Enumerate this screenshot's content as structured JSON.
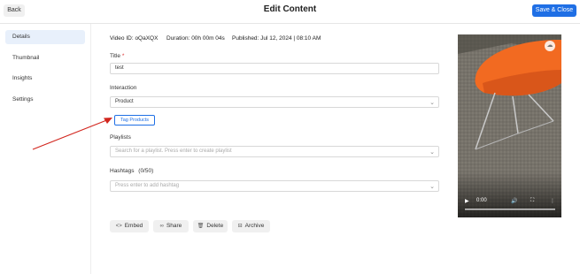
{
  "header": {
    "back_label": "Back",
    "title": "Edit Content",
    "save_label": "Save & Close"
  },
  "sidebar": {
    "items": [
      {
        "label": "Details",
        "active": true
      },
      {
        "label": "Thumbnail",
        "active": false
      },
      {
        "label": "Insights",
        "active": false
      },
      {
        "label": "Settings",
        "active": false
      }
    ]
  },
  "meta": {
    "video_id_label": "Video ID:",
    "video_id": "oQaXQX",
    "duration_label": "Duration:",
    "duration": "00h 00m 04s",
    "published_label": "Published:",
    "published": "Jul 12, 2024 | 08:10 AM"
  },
  "form": {
    "title_label": "Title",
    "title_required_mark": "*",
    "title_value": "test",
    "interaction_label": "Interaction",
    "interaction_value": "Product",
    "tag_products_label": "Tag Products",
    "playlists_label": "Playlists",
    "playlists_placeholder": "Search for a playlist. Press enter to create playlist",
    "hashtags_label": "Hashtags",
    "hashtags_count": "(0/50)",
    "hashtags_placeholder": "Press enter to add hashtag"
  },
  "actions": {
    "embed_label": "Embed",
    "share_label": "Share",
    "delete_label": "Delete",
    "archive_label": "Archive"
  },
  "video": {
    "time": "0:00"
  },
  "icons": {
    "embed": "code-icon",
    "share": "link-icon",
    "delete": "trash-icon",
    "archive": "archive-icon",
    "upload": "cloud-upload-icon",
    "play": "play-icon",
    "volume": "volume-icon",
    "fullscreen": "fullscreen-icon",
    "more": "more-vertical-icon"
  },
  "colors": {
    "accent": "#1f6fe5",
    "sidebar_active_bg": "#e8f0fb",
    "annotation_arrow": "#d2261e",
    "chair": "#f26a21"
  }
}
